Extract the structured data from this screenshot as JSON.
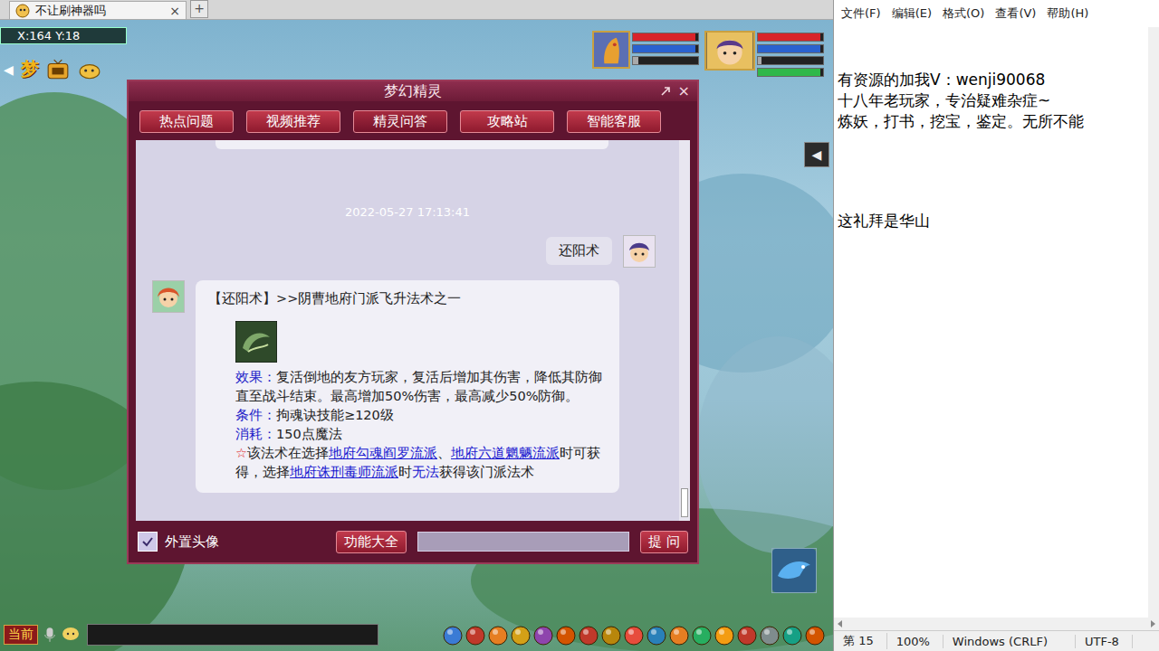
{
  "browser_tab": {
    "title": "不让刷神器吗",
    "close": "×",
    "new_tab": "+"
  },
  "hud": {
    "coords": "X:164 Y:18",
    "menu_glyph": "梦",
    "back_arrow": "◀",
    "side_toggle": "◀",
    "pet_bars": [
      {
        "name": "hp",
        "level": 0.96,
        "color": "#d8242a"
      },
      {
        "name": "mp",
        "level": 0.96,
        "color": "#2a62d0"
      },
      {
        "name": "exp",
        "level": 0.08,
        "color": "#a9a9a9"
      }
    ],
    "player_bars": [
      {
        "name": "hp",
        "level": 0.96,
        "color": "#d8242a"
      },
      {
        "name": "mp",
        "level": 0.96,
        "color": "#2a62d0"
      },
      {
        "name": "anger",
        "level": 0.05,
        "color": "#a9a9a9"
      },
      {
        "name": "exp",
        "level": 0.96,
        "color": "#2fb84a"
      }
    ]
  },
  "dialog": {
    "title": "梦幻精灵",
    "close": "×",
    "tabs": [
      {
        "label": "热点问题",
        "selected": false
      },
      {
        "label": "视频推荐",
        "selected": false
      },
      {
        "label": "精灵问答",
        "selected": true
      },
      {
        "label": "攻略站",
        "selected": false
      },
      {
        "label": "智能客服",
        "selected": false
      }
    ],
    "timestamp": "2022-05-27 17:13:41",
    "question": "还阳术",
    "answer": {
      "heading": "【还阳术】>>阴曹地府门派飞升法术之一",
      "fields": [
        {
          "label": "效果：",
          "value": "复活倒地的友方玩家，复活后增加其伤害，降低其防御直至战斗结束。最高增加50%伤害，最高减少50%防御。"
        },
        {
          "label": "条件：",
          "value": "拘魂诀技能≥120级"
        },
        {
          "label": "消耗：",
          "value": "150点魔法"
        }
      ],
      "note": [
        {
          "kind": "star",
          "text": "☆"
        },
        {
          "kind": "text",
          "text": "该法术在选择"
        },
        {
          "kind": "link",
          "text": "地府勾魂阎罗流派"
        },
        {
          "kind": "text",
          "text": "、"
        },
        {
          "kind": "link",
          "text": "地府六道魍魉流派"
        },
        {
          "kind": "text",
          "text": "时可获得，选择"
        },
        {
          "kind": "link",
          "text": "地府诛刑毒师流派"
        },
        {
          "kind": "text",
          "text": "时"
        },
        {
          "kind": "emph",
          "text": "无法"
        },
        {
          "kind": "text",
          "text": "获得该门派法术"
        }
      ]
    },
    "footer": {
      "avatar_option": {
        "label": "外置头像",
        "checked": true
      },
      "features_button": "功能大全",
      "input": {
        "value": ""
      },
      "ask_button": "提 问"
    }
  },
  "chat_bar": {
    "channel": "当前"
  },
  "notepad": {
    "menu": [
      "文件(F)",
      "编辑(E)",
      "格式(O)",
      "查看(V)",
      "帮助(H)"
    ],
    "blocks": [
      [
        "有资源的加我V：wenji90068",
        "十八年老玩家，专治疑难杂症~",
        "炼妖，打书，挖宝，鉴定。无所不能"
      ],
      [
        "这礼拜是华山"
      ]
    ],
    "status": [
      "第 15",
      "100%",
      "Windows (CRLF)",
      "UTF-8"
    ]
  }
}
